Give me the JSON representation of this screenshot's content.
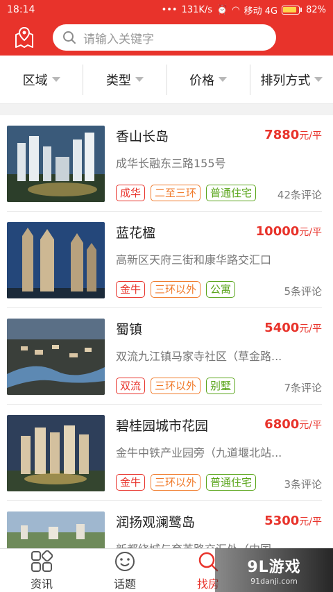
{
  "status": {
    "time": "18:14",
    "speed": "131K/s",
    "carrier": "移动 4G",
    "battery": "82%"
  },
  "search": {
    "placeholder": "请输入关键字"
  },
  "filters": [
    "区域",
    "类型",
    "价格",
    "排列方式"
  ],
  "listings": [
    {
      "name": "香山长岛",
      "price": "7880",
      "unit": "元/平",
      "address": "成华长融东三路155号",
      "tags": [
        {
          "text": "成华",
          "color": "red"
        },
        {
          "text": "二至三环",
          "color": "orange"
        },
        {
          "text": "普通住宅",
          "color": "green"
        }
      ],
      "comments": "42条评论"
    },
    {
      "name": "蓝花楹",
      "price": "10000",
      "unit": "元/平",
      "address": "高新区天府三街和康华路交汇口",
      "tags": [
        {
          "text": "金牛",
          "color": "red"
        },
        {
          "text": "三环以外",
          "color": "orange"
        },
        {
          "text": "公寓",
          "color": "green"
        }
      ],
      "comments": "5条评论"
    },
    {
      "name": "蜀镇",
      "price": "5400",
      "unit": "元/平",
      "address": "双流九江镇马家寺社区（草金路...",
      "tags": [
        {
          "text": "双流",
          "color": "red"
        },
        {
          "text": "三环以外",
          "color": "orange"
        },
        {
          "text": "别墅",
          "color": "green"
        }
      ],
      "comments": "7条评论"
    },
    {
      "name": "碧桂园城市花园",
      "price": "6800",
      "unit": "元/平",
      "address": "金牛中铁产业园旁（九道堰北站...",
      "tags": [
        {
          "text": "金牛",
          "color": "red"
        },
        {
          "text": "三环以外",
          "color": "orange"
        },
        {
          "text": "普通住宅",
          "color": "green"
        }
      ],
      "comments": "3条评论"
    },
    {
      "name": "润扬观澜鹭岛",
      "price": "5300",
      "unit": "元/平",
      "address": "新都绕城与育英路交汇处（中国...",
      "tags": [],
      "comments": ""
    }
  ],
  "nav": [
    {
      "label": "资讯",
      "icon": "grid-icon"
    },
    {
      "label": "话题",
      "icon": "smiley-icon"
    },
    {
      "label": "找房",
      "icon": "search-icon",
      "active": true
    }
  ],
  "watermark": {
    "big": "9L游戏",
    "small": "91danji.com"
  },
  "colors": {
    "brand": "#e8332b",
    "orange": "#f07a2a",
    "green": "#5aa51b"
  }
}
